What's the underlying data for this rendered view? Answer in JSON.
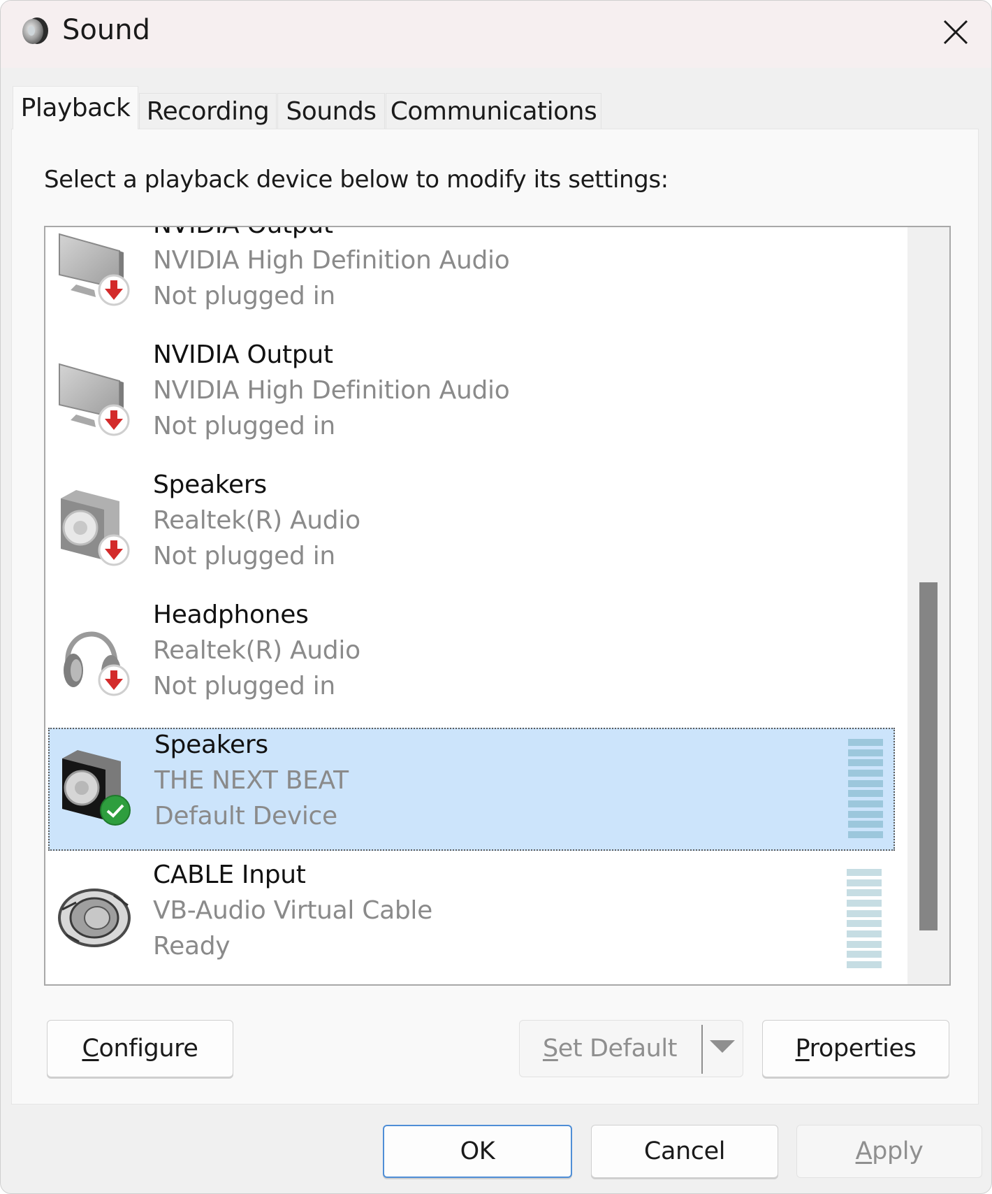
{
  "window": {
    "title": "Sound",
    "title_icon": "speaker-icon",
    "close_icon": "close-icon"
  },
  "tabs": [
    {
      "label": "Playback",
      "active": true
    },
    {
      "label": "Recording",
      "active": false
    },
    {
      "label": "Sounds",
      "active": false
    },
    {
      "label": "Communications",
      "active": false
    }
  ],
  "instruction": "Select a playback device below to modify its settings:",
  "devices": [
    {
      "name": "NVIDIA Output",
      "description": "NVIDIA High Definition Audio",
      "status": "Not plugged in",
      "icon": "monitor-icon",
      "badge": "unplugged-badge-icon",
      "selected": false,
      "meter": false
    },
    {
      "name": "NVIDIA Output",
      "description": "NVIDIA High Definition Audio",
      "status": "Not plugged in",
      "icon": "monitor-icon",
      "badge": "unplugged-badge-icon",
      "selected": false,
      "meter": false
    },
    {
      "name": "Speakers",
      "description": "Realtek(R) Audio",
      "status": "Not plugged in",
      "icon": "speaker-icon",
      "badge": "unplugged-badge-icon",
      "selected": false,
      "meter": false
    },
    {
      "name": "Headphones",
      "description": "Realtek(R) Audio",
      "status": "Not plugged in",
      "icon": "headphones-icon",
      "badge": "unplugged-badge-icon",
      "selected": false,
      "meter": false
    },
    {
      "name": "Speakers",
      "description": "THE NEXT BEAT",
      "status": "Default Device",
      "icon": "speaker-icon",
      "badge": "default-check-badge-icon",
      "selected": true,
      "meter": true
    },
    {
      "name": "CABLE Input",
      "description": "VB-Audio Virtual Cable",
      "status": "Ready",
      "icon": "cable-icon",
      "badge": null,
      "selected": false,
      "meter": true
    }
  ],
  "meter_level": 0,
  "buttons": {
    "configure": {
      "pre": "",
      "accel": "C",
      "post": "onfigure"
    },
    "set_default": {
      "pre": "",
      "accel": "S",
      "post": "et Default",
      "disabled": true
    },
    "properties": {
      "pre": "",
      "accel": "P",
      "post": "roperties"
    },
    "ok": "OK",
    "cancel": "Cancel",
    "apply": {
      "pre": "",
      "accel": "A",
      "post": "pply",
      "disabled": true
    }
  },
  "colors": {
    "selection": "#cce4fb",
    "meter_selected": "#9cc7dc",
    "meter_normal": "#c6dde3",
    "unplugged_red": "#d32a2a",
    "default_green": "#2e9e3e",
    "primary_border": "#4f8ed6"
  }
}
